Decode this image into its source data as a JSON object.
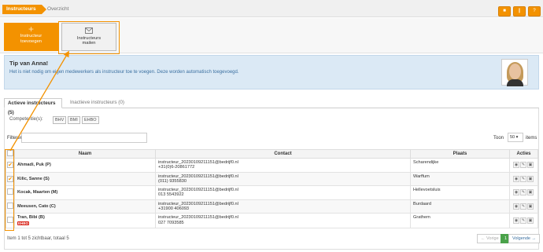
{
  "breadcrumb": {
    "active": "Instructeurs",
    "next": "Overzicht"
  },
  "top_buttons": [
    {
      "icon": "building-icon",
      "glyph": "■"
    },
    {
      "icon": "pause-icon",
      "glyph": "❙"
    },
    {
      "icon": "help-icon",
      "glyph": "?"
    }
  ],
  "actions": {
    "add_line1": "Instructeur",
    "add_line2": "toevoegen",
    "mail_line1": "Instructeurs",
    "mail_line2": "mailen"
  },
  "tip": {
    "title": "Tip van Anna!",
    "text": "Het is niet nodig om eigen medewerkers als instructeur toe te voegen. Deze worden automatisch toegevoegd."
  },
  "tabs": [
    {
      "label": "Actieve instructeurs (5)"
    },
    {
      "label": "Inactieve instructeurs (0)"
    }
  ],
  "competencies": {
    "label": "Competentie(s):",
    "items": [
      "BHV",
      "BMI",
      "EHBO"
    ]
  },
  "filter": {
    "label": "Filteren",
    "value": ""
  },
  "page_size": {
    "label": "Toon",
    "value": "50",
    "suffix": "items"
  },
  "table": {
    "headers": [
      "Naam",
      "Contact",
      "Plaats",
      "Acties"
    ],
    "rows": [
      {
        "checked": true,
        "name": "Ahmadi, Puk (P)",
        "email": "instructeur_20230109211151@bedrijf0.nl",
        "phone": "+31(0)6-20861772",
        "place": "Scharendijke",
        "badge": ""
      },
      {
        "checked": true,
        "name": "Kilic, Sanne (S)",
        "email": "instructeur_20230109211151@bedrijf0.nl",
        "phone": "(011) 9355830",
        "place": "Warffum",
        "badge": ""
      },
      {
        "checked": false,
        "name": "Kocak, Maarten (M)",
        "email": "instructeur_20230109211151@bedrijf0.nl",
        "phone": "013 5543922",
        "place": "Hellevoetsluis",
        "badge": ""
      },
      {
        "checked": false,
        "name": "Meeusen, Cato (C)",
        "email": "instructeur_20230109211151@bedrijf0.nl",
        "phone": "+31900 406093",
        "place": "Burdaard",
        "badge": ""
      },
      {
        "checked": false,
        "name": "Tran, Bibi (B)",
        "email": "instructeur_20230109211151@bedrijf0.nl",
        "phone": "027 7093585",
        "place": "Grathem",
        "badge": "EHBO"
      }
    ]
  },
  "footer": {
    "info": "Item 1 tot 5 zichtbaar, totaal 5",
    "prev": "← Vorige",
    "page": "1",
    "next": "Volgende →"
  },
  "colors": {
    "accent": "#f39200",
    "tip_bg": "#dbe9f5",
    "badge": "#d9261c",
    "current_page": "#4aa24a"
  }
}
